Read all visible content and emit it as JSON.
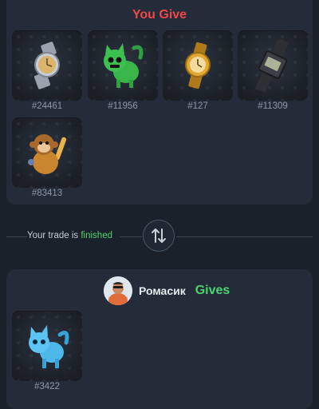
{
  "give_section": {
    "title": "You Give",
    "title_color": "#f0484a",
    "items": [
      {
        "id": "#24461",
        "icon": "silver-watch-icon"
      },
      {
        "id": "#11956",
        "icon": "green-cat-icon"
      },
      {
        "id": "#127",
        "icon": "gold-watch-icon"
      },
      {
        "id": "#11309",
        "icon": "digital-watch-icon"
      },
      {
        "id": "#83413",
        "icon": "monkey-icon"
      }
    ]
  },
  "trade_status": {
    "prefix": "Your trade is",
    "status": "finished",
    "status_color": "#4cd46f",
    "swap_icon": "swap-arrows-icon"
  },
  "gets_section": {
    "user_name": "Ромасик",
    "action": "Gives",
    "action_color": "#4cd46f",
    "items": [
      {
        "id": "#3422",
        "icon": "blue-cat-icon"
      }
    ]
  }
}
